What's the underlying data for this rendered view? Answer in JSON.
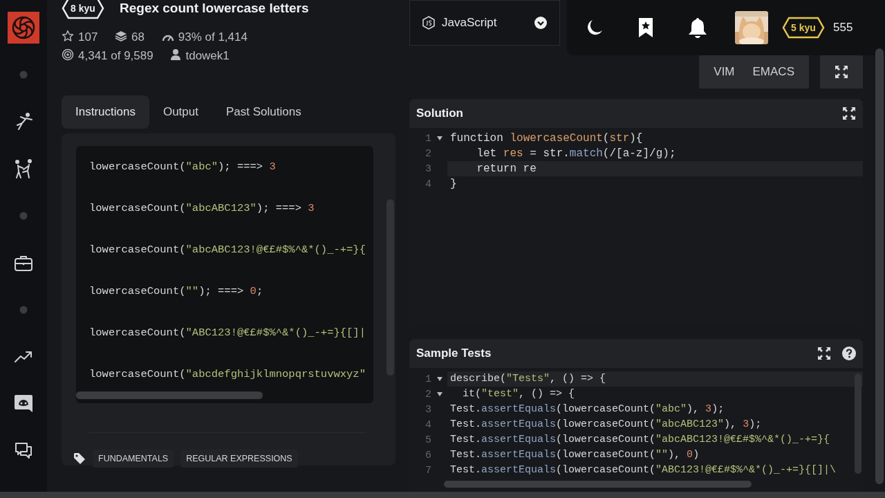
{
  "sidebar": {
    "items": [
      {
        "kind": "logo"
      },
      {
        "kind": "dot"
      },
      {
        "kind": "kick"
      },
      {
        "kind": "spar"
      },
      {
        "kind": "dot"
      },
      {
        "kind": "case"
      },
      {
        "kind": "dot"
      },
      {
        "kind": "trend"
      },
      {
        "kind": "discord"
      },
      {
        "kind": "chat"
      }
    ]
  },
  "kata": {
    "rank": "8 kyu",
    "title": "Regex count lowercase letters",
    "stats": [
      {
        "kind": "stars",
        "text": "107"
      },
      {
        "kind": "collections",
        "text": "68"
      },
      {
        "kind": "satisfaction",
        "text": "93% of 1,414"
      },
      {
        "kind": "completed",
        "text": "4,341 of 9,589"
      },
      {
        "kind": "author",
        "text": "tdowek1"
      }
    ]
  },
  "tabs": [
    {
      "label": "Instructions",
      "selected": true
    },
    {
      "label": "Output",
      "selected": false
    },
    {
      "label": "Past Solutions",
      "selected": false
    }
  ],
  "instructions": {
    "lines": [
      [
        {
          "text": "lowercaseCount(",
          "kind": "plain"
        },
        {
          "text": "\"abc\"",
          "kind": "string"
        },
        {
          "text": "); ===> ",
          "kind": "plain"
        },
        {
          "text": "3",
          "kind": "number"
        }
      ],
      [
        {
          "text": "lowercaseCount(",
          "kind": "plain"
        },
        {
          "text": "\"abcABC123\"",
          "kind": "string"
        },
        {
          "text": "); ===> ",
          "kind": "plain"
        },
        {
          "text": "3",
          "kind": "number"
        }
      ],
      [
        {
          "text": "lowercaseCount(",
          "kind": "plain"
        },
        {
          "text": "\"abcABC123!@€£#$%^&*()_-+=}{",
          "kind": "string"
        }
      ],
      [
        {
          "text": "lowercaseCount(",
          "kind": "plain"
        },
        {
          "text": "\"\"",
          "kind": "string"
        },
        {
          "text": "); ===> ",
          "kind": "plain"
        },
        {
          "text": "0",
          "kind": "number"
        },
        {
          "text": ";",
          "kind": "plain"
        }
      ],
      [
        {
          "text": "lowercaseCount(",
          "kind": "plain"
        },
        {
          "text": "\"ABC123!@€£#$%^&*()_-+=}{[]|",
          "kind": "string"
        }
      ],
      [
        {
          "text": "lowercaseCount(",
          "kind": "plain"
        },
        {
          "text": "\"abcdefghijklmnopqrstuvwxyz\"",
          "kind": "string"
        }
      ]
    ],
    "tags": [
      "FUNDAMENTALS",
      "REGULAR EXPRESSIONS"
    ]
  },
  "language": {
    "label": "JavaScript"
  },
  "topbar": {
    "icons": [
      {
        "kind": "moon"
      },
      {
        "kind": "bookmark"
      },
      {
        "kind": "bell"
      }
    ],
    "rank": "5 kyu",
    "honor": "555"
  },
  "modes": [
    {
      "label": "VIM",
      "selected": false
    },
    {
      "label": "EMACS",
      "selected": false
    }
  ],
  "solution": {
    "title": "Solution",
    "lines": [
      {
        "number": "1",
        "foldable": true,
        "active": false,
        "segments": [
          {
            "text": "function ",
            "kind": "plain"
          },
          {
            "text": "lowercaseCount",
            "kind": "name"
          },
          {
            "text": "(",
            "kind": "plain"
          },
          {
            "text": "str",
            "kind": "name"
          },
          {
            "text": "){",
            "kind": "plain"
          }
        ]
      },
      {
        "number": "2",
        "foldable": false,
        "active": false,
        "segments": [
          {
            "text": "    let ",
            "kind": "plain"
          },
          {
            "text": "res",
            "kind": "name"
          },
          {
            "text": " = str.",
            "kind": "plain"
          },
          {
            "text": "match",
            "kind": "method"
          },
          {
            "text": "(/[a-z]/g);",
            "kind": "plain"
          }
        ]
      },
      {
        "number": "3",
        "foldable": false,
        "active": true,
        "segments": [
          {
            "text": "    return re",
            "kind": "plain"
          }
        ]
      },
      {
        "number": "4",
        "foldable": false,
        "active": false,
        "segments": [
          {
            "text": "}",
            "kind": "plain"
          }
        ]
      }
    ]
  },
  "sample_tests": {
    "title": "Sample Tests",
    "lines": [
      {
        "number": "1",
        "foldable": true,
        "active": true,
        "segments": [
          {
            "text": "describe(",
            "kind": "plain"
          },
          {
            "text": "\"Tests\"",
            "kind": "string"
          },
          {
            "text": ", () => {",
            "kind": "plain"
          }
        ]
      },
      {
        "number": "2",
        "foldable": true,
        "active": false,
        "segments": [
          {
            "text": "  it(",
            "kind": "plain"
          },
          {
            "text": "\"test\"",
            "kind": "string"
          },
          {
            "text": ", () => {",
            "kind": "plain"
          }
        ]
      },
      {
        "number": "3",
        "foldable": false,
        "active": false,
        "segments": [
          {
            "text": "Test.",
            "kind": "plain"
          },
          {
            "text": "assertEquals",
            "kind": "method"
          },
          {
            "text": "(lowercaseCount(",
            "kind": "plain"
          },
          {
            "text": "\"abc\"",
            "kind": "string"
          },
          {
            "text": "), ",
            "kind": "plain"
          },
          {
            "text": "3",
            "kind": "number"
          },
          {
            "text": ");",
            "kind": "plain"
          }
        ]
      },
      {
        "number": "4",
        "foldable": false,
        "active": false,
        "segments": [
          {
            "text": "Test.",
            "kind": "plain"
          },
          {
            "text": "assertEquals",
            "kind": "method"
          },
          {
            "text": "(lowercaseCount(",
            "kind": "plain"
          },
          {
            "text": "\"abcABC123\"",
            "kind": "string"
          },
          {
            "text": "), ",
            "kind": "plain"
          },
          {
            "text": "3",
            "kind": "number"
          },
          {
            "text": ");",
            "kind": "plain"
          }
        ]
      },
      {
        "number": "5",
        "foldable": false,
        "active": false,
        "segments": [
          {
            "text": "Test.",
            "kind": "plain"
          },
          {
            "text": "assertEquals",
            "kind": "method"
          },
          {
            "text": "(lowercaseCount(",
            "kind": "plain"
          },
          {
            "text": "\"abcABC123!@€£#$%^&*()_-+=}{",
            "kind": "string"
          }
        ]
      },
      {
        "number": "6",
        "foldable": false,
        "active": false,
        "segments": [
          {
            "text": "Test.",
            "kind": "plain"
          },
          {
            "text": "assertEquals",
            "kind": "method"
          },
          {
            "text": "(lowercaseCount(",
            "kind": "plain"
          },
          {
            "text": "\"\"",
            "kind": "string"
          },
          {
            "text": "), ",
            "kind": "plain"
          },
          {
            "text": "0",
            "kind": "number"
          },
          {
            "text": ")",
            "kind": "plain"
          }
        ]
      },
      {
        "number": "7",
        "foldable": false,
        "active": false,
        "segments": [
          {
            "text": "Test.",
            "kind": "plain"
          },
          {
            "text": "assertEquals",
            "kind": "method"
          },
          {
            "text": "(lowercaseCount(",
            "kind": "plain"
          },
          {
            "text": "\"ABC123!@€£#$%^&*()_-+=}{[]|\\",
            "kind": "string"
          }
        ]
      }
    ]
  }
}
